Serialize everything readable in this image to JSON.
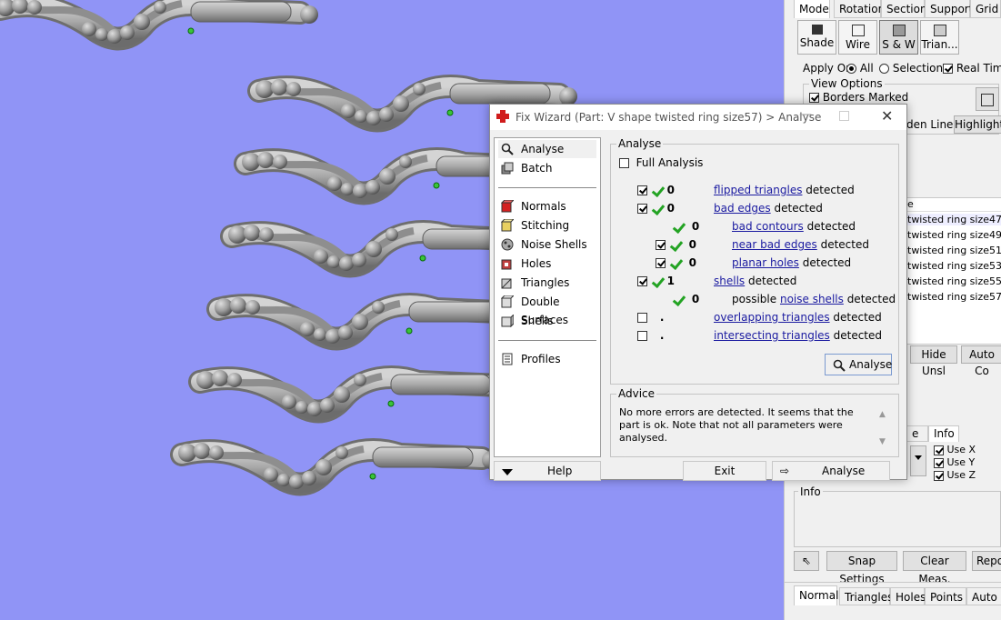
{
  "right_panel": {
    "tabs": [
      "Mode",
      "Rotation",
      "Section",
      "Support",
      "Grid"
    ],
    "mode_buttons": [
      "Shade",
      "Wire",
      "S & W",
      "Trian..."
    ],
    "apply_on": {
      "label": "Apply On",
      "all": "All",
      "selection": "Selection",
      "real_time": "Real Time"
    },
    "view_options": {
      "title": "View Options",
      "borders_marked": "Borders Marked",
      "hidden_line": "den Line",
      "highlight": "Highlight"
    },
    "part_list_header": "e",
    "parts": [
      "twisted ring size47",
      "twisted ring size49",
      "twisted ring size51",
      "twisted ring size53",
      "twisted ring size55",
      "twisted ring size57"
    ],
    "hide_unsel": "Hide Unsl",
    "auto_color": "Auto Co",
    "lower_tabs": [
      "e",
      "Info"
    ],
    "use_axes": [
      "Use X",
      "Use Y",
      "Use Z"
    ],
    "info_title": "Info",
    "snap_settings": "Snap Settings",
    "clear_meas": "Clear Meas.",
    "report": "Repor",
    "bottom_tabs": [
      "Normals",
      "Triangles",
      "Holes",
      "Points",
      "Auto"
    ]
  },
  "dialog": {
    "title": "Fix Wizard (Part: V shape twisted ring size57) > Analyse",
    "nav": {
      "top": [
        "Analyse",
        "Batch"
      ],
      "middle": [
        "Normals",
        "Stitching",
        "Noise Shells",
        "Holes",
        "Triangles",
        "Double Surfaces",
        "Shells"
      ],
      "bottom": [
        "Profiles"
      ],
      "help": "Help"
    },
    "analyse_group": "Analyse",
    "full_analysis": "Full Analysis",
    "detected_word": "detected",
    "rows": [
      {
        "num": "0",
        "link": "flipped triangles",
        "prefix": ""
      },
      {
        "num": "0",
        "link": "bad edges",
        "prefix": ""
      },
      {
        "num": "0",
        "link": "bad contours",
        "prefix": ""
      },
      {
        "num": "0",
        "link": "near bad edges",
        "prefix": ""
      },
      {
        "num": "0",
        "link": "planar holes",
        "prefix": ""
      },
      {
        "num": "1",
        "link": "shells",
        "prefix": ""
      },
      {
        "num": "0",
        "link": "noise shells",
        "prefix": "possible"
      },
      {
        "num": ".",
        "link": "overlapping triangles",
        "prefix": ""
      },
      {
        "num": ".",
        "link": "intersecting triangles",
        "prefix": ""
      }
    ],
    "analyse_button": "Analyse",
    "advice_title": "Advice",
    "advice_text": "No more errors are detected. It seems that the part is ok. Note that not all parameters were analysed.",
    "exit_button": "Exit",
    "next_analyse_button": "Analyse"
  }
}
